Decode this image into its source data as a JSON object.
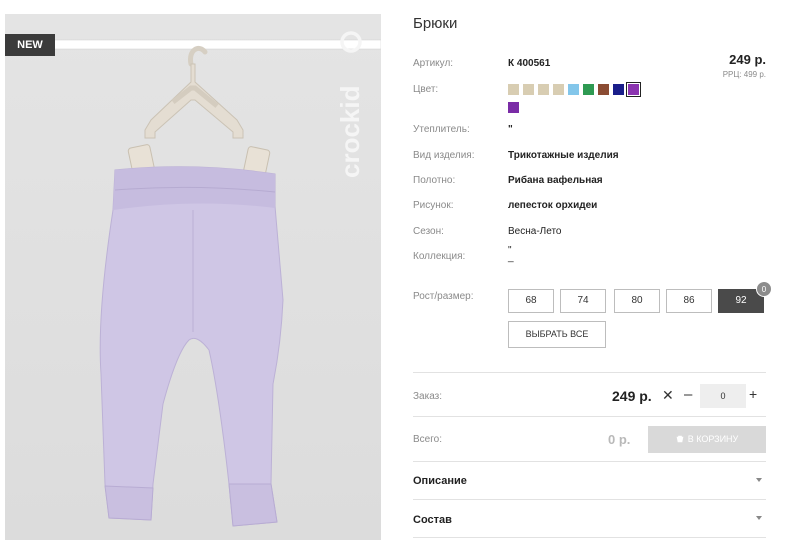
{
  "product": {
    "title": "Брюки",
    "badge": "NEW",
    "price": "249 р.",
    "rrc": "РРЦ: 499 р."
  },
  "attributes": {
    "article": {
      "label": "Артикул:",
      "value": "К 400561"
    },
    "color": {
      "label": "Цвет:"
    },
    "insulation": {
      "label": "Утеплитель:",
      "value": "\""
    },
    "type": {
      "label": "Вид изделия:",
      "value": "Трикотажные изделия"
    },
    "fabric": {
      "label": "Полотно:",
      "value": "Рибана вафельная"
    },
    "pattern": {
      "label": "Рисунок:",
      "value": "лепесток орхидеи"
    },
    "season": {
      "label": "Сезон:",
      "value": "Весна-Лето"
    },
    "collection": {
      "label": "Коллекция:",
      "value": "\"\n_"
    }
  },
  "colors": {
    "swatches": [
      "#d8cdb2",
      "#d8cdb2",
      "#d8cdb2",
      "#d8cdb2",
      "#83c6ea",
      "#2e9a52",
      "#8b4c33",
      "#1a1e8a",
      "#8b34b0",
      "#7a2ca6"
    ],
    "selected_index": 8
  },
  "sizes": {
    "label": "Рост/размер:",
    "options": [
      "68",
      "74",
      "80",
      "86",
      "92"
    ],
    "active": "92",
    "count": "0",
    "select_all": "ВЫБРАТЬ ВСЕ"
  },
  "order": {
    "label": "Заказ:",
    "price": "249 р.",
    "times": "✕",
    "minus": "–",
    "quantity": "0",
    "plus": "+"
  },
  "total": {
    "label": "Всего:",
    "value": "0 р.",
    "cart_button": "В КОРЗИНУ"
  },
  "accordion": {
    "description": "Описание",
    "composition": "Состав"
  },
  "brand": {
    "logo_text": "crockid"
  }
}
